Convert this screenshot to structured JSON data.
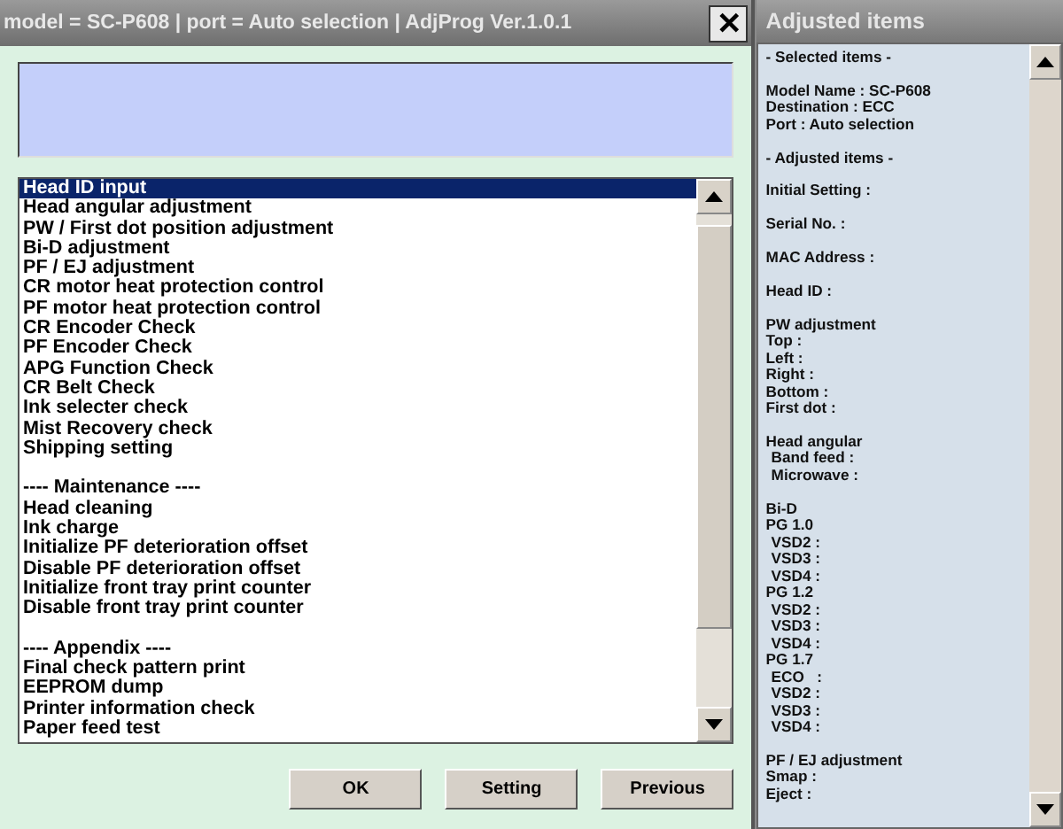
{
  "window": {
    "title": "model = SC-P608 | port = Auto selection | AdjProg Ver.1.0.1",
    "close": "✕"
  },
  "menu_list": [
    {
      "label": "Head ID input",
      "kind": "item",
      "selected": true
    },
    {
      "label": "Head angular adjustment",
      "kind": "item",
      "selected": false
    },
    {
      "label": "PW / First dot position adjustment",
      "kind": "item",
      "selected": false
    },
    {
      "label": "Bi-D adjustment",
      "kind": "item",
      "selected": false
    },
    {
      "label": "PF / EJ adjustment",
      "kind": "item",
      "selected": false
    },
    {
      "label": "CR motor heat protection control",
      "kind": "item",
      "selected": false
    },
    {
      "label": "PF motor heat protection control",
      "kind": "item",
      "selected": false
    },
    {
      "label": "CR Encoder Check",
      "kind": "item",
      "selected": false
    },
    {
      "label": "PF Encoder Check",
      "kind": "item",
      "selected": false
    },
    {
      "label": "APG Function Check",
      "kind": "item",
      "selected": false
    },
    {
      "label": "CR Belt Check",
      "kind": "item",
      "selected": false
    },
    {
      "label": "Ink selecter check",
      "kind": "item",
      "selected": false
    },
    {
      "label": "Mist Recovery check",
      "kind": "item",
      "selected": false
    },
    {
      "label": "Shipping setting",
      "kind": "item",
      "selected": false
    },
    {
      "label": "---- Maintenance ----",
      "kind": "heading",
      "selected": false
    },
    {
      "label": "Head cleaning",
      "kind": "item",
      "selected": false
    },
    {
      "label": "Ink charge",
      "kind": "item",
      "selected": false
    },
    {
      "label": "Initialize PF deterioration offset",
      "kind": "item",
      "selected": false
    },
    {
      "label": "Disable PF deterioration offset",
      "kind": "item",
      "selected": false
    },
    {
      "label": "Initialize front tray print counter",
      "kind": "item",
      "selected": false
    },
    {
      "label": "Disable front tray print counter",
      "kind": "item",
      "selected": false
    },
    {
      "label": "---- Appendix ----",
      "kind": "heading",
      "selected": false
    },
    {
      "label": "Final check pattern print",
      "kind": "item",
      "selected": false
    },
    {
      "label": "EEPROM dump",
      "kind": "item",
      "selected": false
    },
    {
      "label": "Printer information check",
      "kind": "item",
      "selected": false
    },
    {
      "label": "Paper feed test",
      "kind": "item",
      "selected": false
    }
  ],
  "buttons": [
    "OK",
    "Setting",
    "Previous"
  ],
  "side_panel": {
    "title": "Adjusted items",
    "groups": [
      [
        {
          "text": "- Selected items -"
        }
      ],
      [
        {
          "text": "Model Name : SC-P608"
        },
        {
          "text": "Destination : ECC"
        },
        {
          "text": "Port : Auto selection"
        }
      ],
      [
        {
          "text": "- Adjusted items -"
        }
      ],
      [
        {
          "text": "Initial Setting :"
        }
      ],
      [
        {
          "text": "Serial No. :"
        }
      ],
      [
        {
          "text": "MAC Address :"
        }
      ],
      [
        {
          "text": "Head ID :"
        }
      ],
      [
        {
          "text": "PW adjustment"
        },
        {
          "text": "Top :"
        },
        {
          "text": "Left :"
        },
        {
          "text": "Right :"
        },
        {
          "text": "Bottom :"
        },
        {
          "text": "First dot :"
        }
      ],
      [
        {
          "text": "Head angular",
          "children": [
            {
              "text": "Band feed :"
            },
            {
              "text": "Microwave :"
            }
          ]
        }
      ],
      [
        {
          "text": "Bi-D"
        },
        {
          "text": "PG 1.0",
          "children": [
            {
              "text": "VSD2 :"
            },
            {
              "text": "VSD3 :"
            },
            {
              "text": "VSD4 :"
            }
          ]
        },
        {
          "text": "PG 1.2",
          "children": [
            {
              "text": "VSD2 :"
            },
            {
              "text": "VSD3 :"
            },
            {
              "text": "VSD4 :"
            }
          ]
        },
        {
          "text": "PG 1.7",
          "children": [
            {
              "text": "ECO   :"
            },
            {
              "text": "VSD2 :"
            },
            {
              "text": "VSD3 :"
            },
            {
              "text": "VSD4 :"
            }
          ]
        }
      ],
      [
        {
          "text": "PF / EJ adjustment"
        },
        {
          "text": "Smap :"
        },
        {
          "text": "Eject :"
        }
      ]
    ]
  }
}
